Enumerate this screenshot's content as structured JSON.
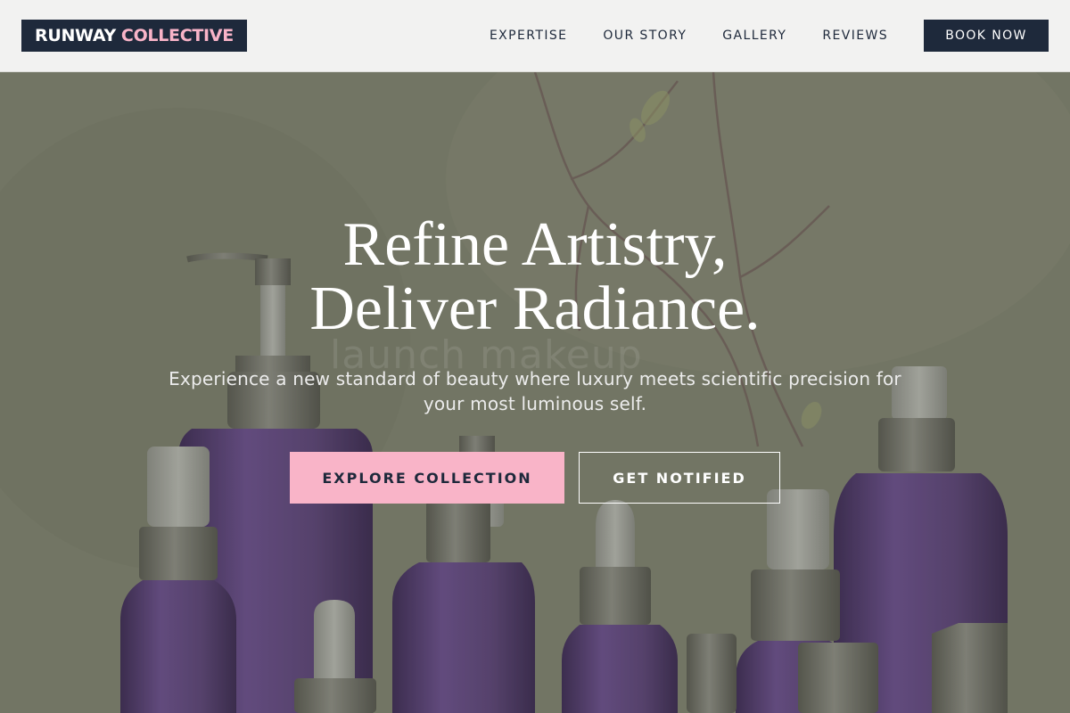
{
  "nav": {
    "brand": {
      "part_a": "RUNWAY",
      "part_b": "COLLECTIVE"
    },
    "links": [
      {
        "label": "EXPERTISE"
      },
      {
        "label": "OUR STORY"
      },
      {
        "label": "GALLERY"
      },
      {
        "label": "REVIEWS"
      }
    ],
    "cta": "BOOK NOW"
  },
  "hero": {
    "title_line1": "Refine Artistry,",
    "title_line2": "Deliver Radiance.",
    "subtitle": "Experience a new standard of beauty where luxury meets scientific precision for your most luminous self.",
    "primary_button": "EXPLORE COLLECTION",
    "secondary_button": "GET NOTIFIED",
    "watermark": "launch makeup"
  },
  "colors": {
    "navy": "#1e293b",
    "pink": "#f9b4c8",
    "nav_bg": "#f2f2f1",
    "hero_bg": "#7d8170",
    "bottle_purple": "#5b4378"
  }
}
